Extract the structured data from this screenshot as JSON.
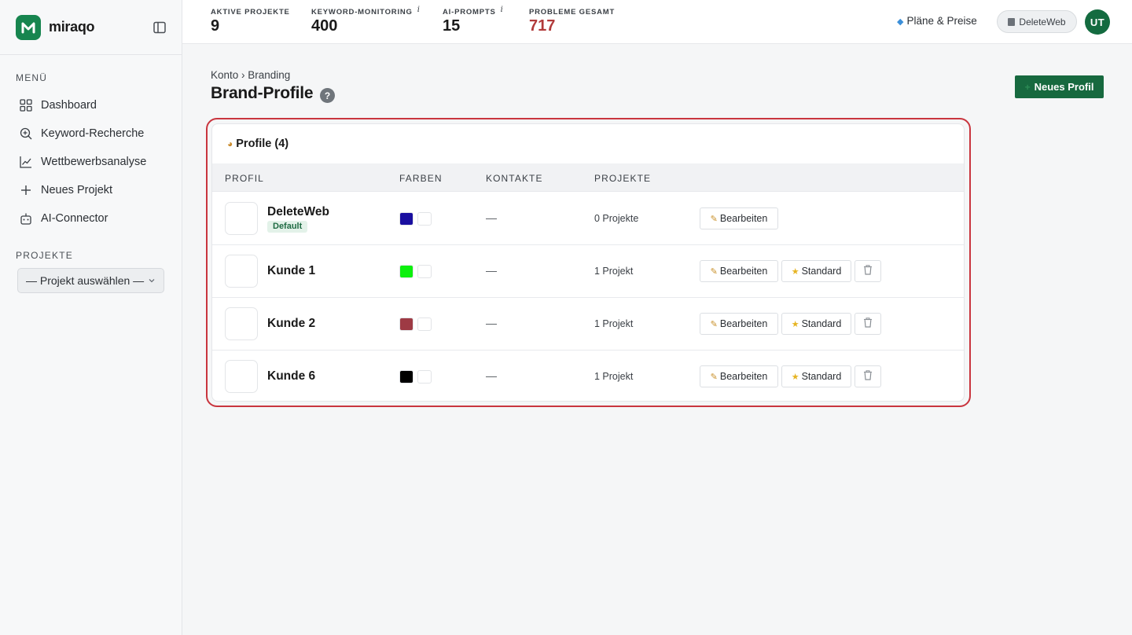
{
  "brand": {
    "name": "miraqo"
  },
  "sidebar": {
    "menu_label": "MENÜ",
    "items": [
      {
        "label": "Dashboard",
        "icon": "dashboard-grid-icon"
      },
      {
        "label": "Keyword-Recherche",
        "icon": "search-plus-icon"
      },
      {
        "label": "Wettbewerbsanalyse",
        "icon": "line-chart-icon"
      },
      {
        "label": "Neues Projekt",
        "icon": "plus-icon"
      },
      {
        "label": "AI-Connector",
        "icon": "robot-icon"
      }
    ],
    "projects_label": "PROJEKTE",
    "project_select": "— Projekt auswählen —"
  },
  "topbar": {
    "stats": [
      {
        "label": "AKTIVE PROJEKTE",
        "value": "9",
        "info": ""
      },
      {
        "label": "KEYWORD-MONITORING",
        "value": "400",
        "info": "i"
      },
      {
        "label": "AI-PROMPTS",
        "value": "15",
        "info": "i"
      },
      {
        "label": "PROBLEME GESAMT",
        "value": "717",
        "info": ""
      }
    ],
    "plans_link": "Pläne & Preise",
    "account": "DeleteWeb",
    "avatar_initials": "UT"
  },
  "page": {
    "breadcrumb": "Konto › Branding",
    "title": "Brand-Profile",
    "help": "?",
    "new_profile_button": "Neues Profil"
  },
  "card": {
    "title": "Profile (4)",
    "columns": [
      "PROFIL",
      "FARBEN",
      "KONTAKTE",
      "PROJEKTE"
    ],
    "rows": [
      {
        "name": "DeleteWeb",
        "badge": "Default",
        "colors": [
          "#1a0fa0",
          "#ffffff"
        ],
        "contacts": "—",
        "projects": "0 Projekte",
        "edit": "Bearbeiten"
      },
      {
        "name": "Kunde 1",
        "badge": "",
        "colors": [
          "#0df00d",
          "#ffffff"
        ],
        "contacts": "—",
        "projects": "1 Projekt",
        "edit": "Bearbeiten",
        "standard": "Standard"
      },
      {
        "name": "Kunde 2",
        "badge": "",
        "colors": [
          "#9e3a44",
          "#ffffff"
        ],
        "contacts": "—",
        "projects": "1 Projekt",
        "edit": "Bearbeiten",
        "standard": "Standard"
      },
      {
        "name": "Kunde 6",
        "badge": "",
        "colors": [
          "#000000",
          "#ffffff"
        ],
        "contacts": "—",
        "projects": "1 Projekt",
        "edit": "Bearbeiten",
        "standard": "Standard"
      }
    ]
  },
  "colors": {
    "accent": "#17693f",
    "alert": "#b13a3a",
    "highlight": "#c9353e"
  }
}
